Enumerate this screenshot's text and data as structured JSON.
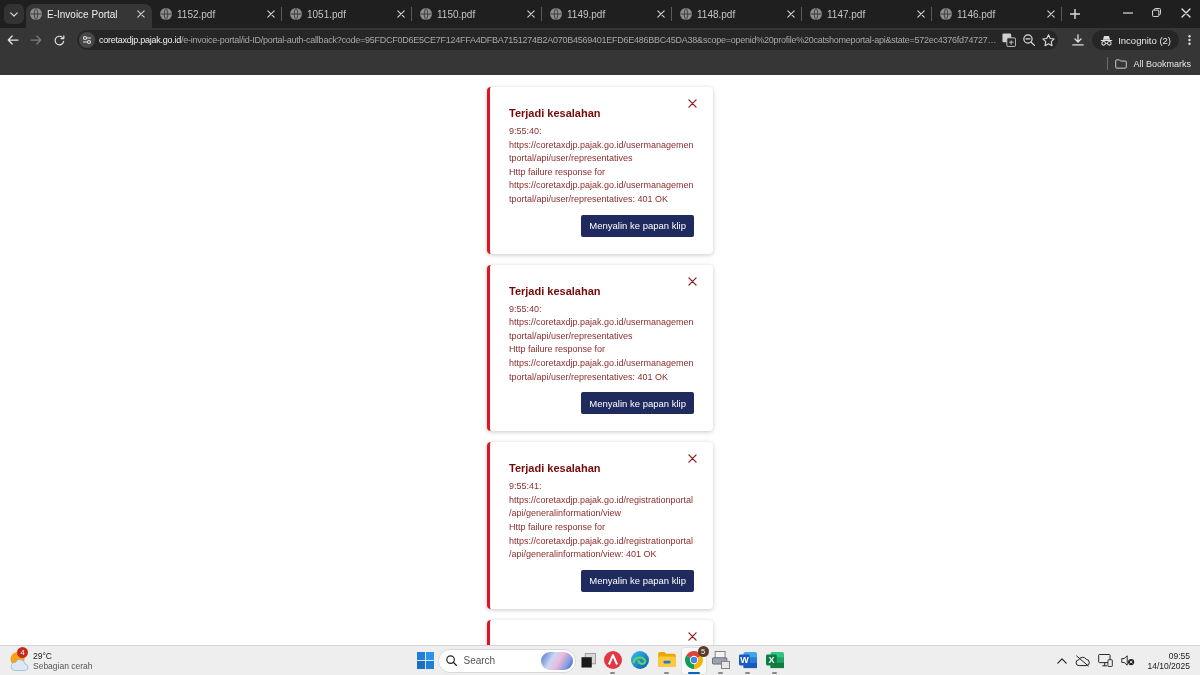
{
  "browser": {
    "tabs": [
      {
        "title": "E-Invoice Portal",
        "selected": true
      },
      {
        "title": "1152.pdf",
        "selected": false
      },
      {
        "title": "1051.pdf",
        "selected": false
      },
      {
        "title": "1150.pdf",
        "selected": false
      },
      {
        "title": "1149.pdf",
        "selected": false
      },
      {
        "title": "1148.pdf",
        "selected": false
      },
      {
        "title": "1147.pdf",
        "selected": false
      },
      {
        "title": "1146.pdf",
        "selected": false
      }
    ],
    "navigation": [
      {
        "kind": "back",
        "disabled": false
      },
      {
        "kind": "forward",
        "disabled": true
      },
      {
        "kind": "reload",
        "disabled": false
      }
    ],
    "address": {
      "host": "coretaxdjp.pajak.go.id",
      "path": "/e-invoice-portal/id-ID/portal-auth-callback?code=95FDCF0D6E5CE7F124FFA4DFBA7151274B2A070B4569401EFD6E486BBC45DA38&scope=openid%20profile%20catshomeportal-api&state=572ec4376fd74727…"
    },
    "profile": "Incognito (2)",
    "bookmarks": [
      {
        "kind": "folder",
        "label": "All Bookmarks"
      }
    ]
  },
  "toasts": [
    {
      "kind": "error",
      "title": "Terjadi kesalahan",
      "message_lines": [
        "9:55:40: https://coretaxdjp.pajak.go.id/usermanagementportal/api/user/representatives",
        "Http failure response for https://coretaxdjp.pajak.go.id/usermanagementportal/api/user/representatives: 401 OK"
      ],
      "button": "Menyalin ke papan klip"
    },
    {
      "kind": "error",
      "title": "Terjadi kesalahan",
      "message_lines": [
        "9:55:40: https://coretaxdjp.pajak.go.id/usermanagementportal/api/user/representatives",
        "Http failure response for https://coretaxdjp.pajak.go.id/usermanagementportal/api/user/representatives: 401 OK"
      ],
      "button": "Menyalin ke papan klip"
    },
    {
      "kind": "error",
      "title": "Terjadi kesalahan",
      "message_lines": [
        "9:55:41: https://coretaxdjp.pajak.go.id/registrationportal/api/generalinformation/view",
        "Http failure response for https://coretaxdjp.pajak.go.id/registrationportal/api/generalinformation/view: 401 OK"
      ],
      "button": "Menyalin ke papan klip"
    },
    {
      "kind": "error"
    }
  ],
  "taskbar": {
    "weather": {
      "badge": "4",
      "temperature": "29°C",
      "condition": "Sebagian cerah"
    },
    "search": {
      "placeholder": "Search"
    },
    "apps": [
      {
        "kind": "letter_a",
        "running": true,
        "active": false
      },
      {
        "kind": "edge",
        "running": false,
        "active": false
      },
      {
        "kind": "folder",
        "running": true,
        "active": false
      },
      {
        "kind": "chrome",
        "running": true,
        "active": true,
        "badge": "5"
      },
      {
        "kind": "scanner",
        "running": true,
        "active": false
      },
      {
        "kind": "word",
        "running": true,
        "active": false,
        "glyph": "W"
      },
      {
        "kind": "excel",
        "running": true,
        "active": false,
        "glyph": "X"
      }
    ],
    "tray": [
      {
        "kind": "chevron"
      },
      {
        "kind": "cloud_off"
      },
      {
        "kind": "network"
      },
      {
        "kind": "volume_muted"
      }
    ],
    "clock": {
      "time": "09:55",
      "date": "14/10/2025"
    }
  }
}
